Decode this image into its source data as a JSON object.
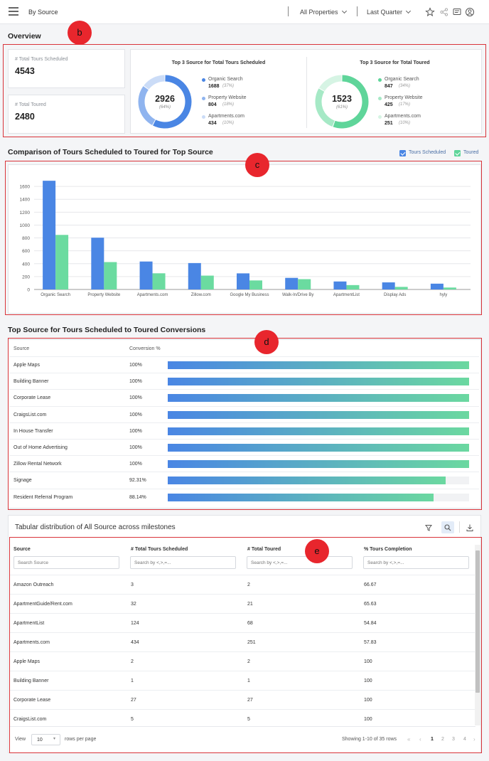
{
  "header": {
    "title": "By Source",
    "property_filter": "All Properties",
    "period_filter": "Last Quarter"
  },
  "markers": {
    "b": "b",
    "c": "c",
    "d": "d",
    "e": "e"
  },
  "overview": {
    "title": "Overview",
    "kpis": [
      {
        "label": "# Total Tours Scheduled",
        "value": "4543"
      },
      {
        "label": "# Total Toured",
        "value": "2480"
      }
    ],
    "top3_scheduled": {
      "title": "Top 3 Source for Total Tours Scheduled",
      "center_value": "2926",
      "center_pct": "(64%)",
      "items": [
        {
          "name": "Organic Search",
          "value": "1688",
          "pct": "(37%)",
          "color": "#4a86e4"
        },
        {
          "name": "Property Website",
          "value": "804",
          "pct": "(18%)",
          "color": "#8fb4ef"
        },
        {
          "name": "Apartments.com",
          "value": "434",
          "pct": "(10%)",
          "color": "#cbdcf7"
        }
      ]
    },
    "top3_toured": {
      "title": "Top 3 Source for Total Toured",
      "center_value": "1523",
      "center_pct": "(61%)",
      "items": [
        {
          "name": "Organic Search",
          "value": "847",
          "pct": "(34%)",
          "color": "#5fd59a"
        },
        {
          "name": "Property Website",
          "value": "425",
          "pct": "(17%)",
          "color": "#a6e9c6"
        },
        {
          "name": "Apartments.com",
          "value": "251",
          "pct": "(10%)",
          "color": "#d6f4e4"
        }
      ]
    }
  },
  "comparison": {
    "title": "Comparison of Tours Scheduled to Toured for Top Source",
    "legend_scheduled": "Tours Scheduled",
    "legend_toured": "Toured"
  },
  "chart_data": {
    "type": "bar",
    "categories": [
      "Organic Search",
      "Property Website",
      "Apartments.com",
      "Zillow.com",
      "Google My Business",
      "Walk-In/Drive By",
      "ApartmentList",
      "Display Ads",
      "hyly"
    ],
    "series": [
      {
        "name": "Tours Scheduled",
        "color": "#4a86e4",
        "values": [
          1688,
          804,
          434,
          410,
          250,
          180,
          124,
          110,
          90
        ]
      },
      {
        "name": "Toured",
        "color": "#6bdba0",
        "values": [
          847,
          425,
          251,
          215,
          140,
          160,
          68,
          40,
          30
        ]
      }
    ],
    "yticks": [
      0,
      200,
      400,
      600,
      800,
      1000,
      1200,
      1400,
      1600
    ],
    "ylim": [
      0,
      1800
    ],
    "grid": true
  },
  "conversions": {
    "title": "Top Source for Tours Scheduled to Toured Conversions",
    "col_source": "Source",
    "col_pct": "Conversion %",
    "rows": [
      {
        "source": "Apple Maps",
        "pct_label": "100%",
        "pct": 100
      },
      {
        "source": "Building Banner",
        "pct_label": "100%",
        "pct": 100
      },
      {
        "source": "Corporate Lease",
        "pct_label": "100%",
        "pct": 100
      },
      {
        "source": "CraigsList.com",
        "pct_label": "100%",
        "pct": 100
      },
      {
        "source": "In House Transfer",
        "pct_label": "100%",
        "pct": 100
      },
      {
        "source": "Out of Home Advertising",
        "pct_label": "100%",
        "pct": 100
      },
      {
        "source": "Zillow Rental Network",
        "pct_label": "100%",
        "pct": 100
      },
      {
        "source": "Signage",
        "pct_label": "92.31%",
        "pct": 92.31
      },
      {
        "source": "Resident Referral Program",
        "pct_label": "88.14%",
        "pct": 88.14
      }
    ]
  },
  "table": {
    "title": "Tabular distribution of All Source across milestones",
    "columns": [
      "Source",
      "# Total Tours Scheduled",
      "# Total Toured",
      "% Tours Completion"
    ],
    "placeholders": [
      "Search Source",
      "Search by <,>,=...",
      "Search by <,>,=...",
      "Search by <,>,=..."
    ],
    "rows": [
      [
        "Amazon Outreach",
        "3",
        "2",
        "66.67"
      ],
      [
        "ApartmentGuide/Rent.com",
        "32",
        "21",
        "65.63"
      ],
      [
        "ApartmentList",
        "124",
        "68",
        "54.84"
      ],
      [
        "Apartments.com",
        "434",
        "251",
        "57.83"
      ],
      [
        "Apple Maps",
        "2",
        "2",
        "100"
      ],
      [
        "Building Banner",
        "1",
        "1",
        "100"
      ],
      [
        "Corporate Lease",
        "27",
        "27",
        "100"
      ],
      [
        "CraigsList.com",
        "5",
        "5",
        "100"
      ]
    ],
    "footer": {
      "view_label": "View",
      "page_size": "10",
      "rows_per_page": "rows per page",
      "showing": "Showing 1-10 of 35 rows",
      "pages": [
        "1",
        "2",
        "3",
        "4"
      ],
      "current_page": "1"
    }
  }
}
